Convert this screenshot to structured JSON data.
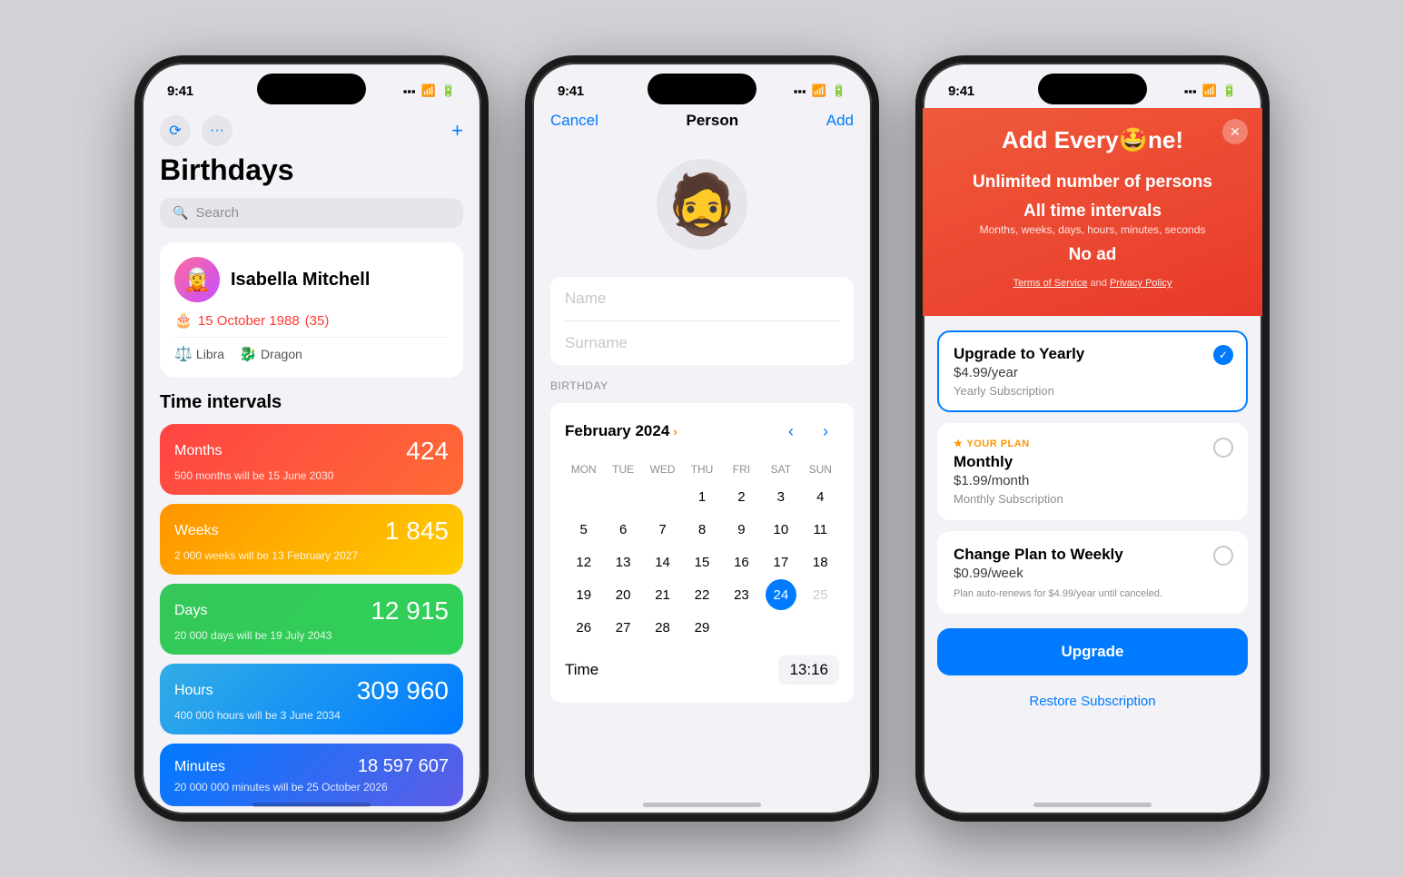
{
  "phone1": {
    "status": {
      "time": "9:41"
    },
    "toolbar": {
      "refresh_icon": "↻",
      "more_icon": "•••",
      "add_icon": "+"
    },
    "title": "Birthdays",
    "search": {
      "placeholder": "Search"
    },
    "person": {
      "name": "Isabella Mitchell",
      "avatar_emoji": "🧝",
      "birthday": "15 October 1988",
      "age": "(35)",
      "birthday_icon": "🎂",
      "zodiac": "Libra",
      "zodiac_icon": "♎",
      "chinese": "Dragon",
      "chinese_icon": "🐉"
    },
    "intervals_title": "Time intervals",
    "intervals": [
      {
        "label": "Months",
        "value": "424",
        "subtitle": "500 months will be 15 June 2030",
        "class": "card-months"
      },
      {
        "label": "Weeks",
        "value": "1 845",
        "subtitle": "2 000 weeks will be 13 February 2027",
        "class": "card-weeks"
      },
      {
        "label": "Days",
        "value": "12 915",
        "subtitle": "20 000 days will be 19 July 2043",
        "class": "card-days"
      },
      {
        "label": "Hours",
        "value": "309 960",
        "subtitle": "400 000 hours will be 3 June 2034",
        "class": "card-hours"
      },
      {
        "label": "Minutes",
        "value": "18 597 607",
        "subtitle": "20 000 000 minutes will be 25 October 2026",
        "class": "card-minutes"
      }
    ]
  },
  "phone2": {
    "status": {
      "time": "9:41"
    },
    "nav": {
      "cancel": "Cancel",
      "title": "Person",
      "add": "Add"
    },
    "form": {
      "name_placeholder": "Name",
      "surname_placeholder": "Surname"
    },
    "birthday_label": "BIRTHDAY",
    "calendar": {
      "month": "February 2024",
      "chevron": "›",
      "days_of_week": [
        "MON",
        "TUE",
        "WED",
        "THU",
        "FRI",
        "SAT",
        "SUN"
      ],
      "weeks": [
        [
          "",
          "",
          "",
          "1",
          "2",
          "3",
          "4"
        ],
        [
          "5",
          "6",
          "7",
          "8",
          "9",
          "10",
          "11"
        ],
        [
          "12",
          "13",
          "14",
          "15",
          "16",
          "17",
          "18"
        ],
        [
          "19",
          "20",
          "21",
          "22",
          "23",
          "24",
          "25"
        ],
        [
          "26",
          "27",
          "28",
          "29",
          "",
          "",
          ""
        ]
      ],
      "selected_day": "24",
      "muted_days": [
        "25",
        "26",
        "27",
        "28",
        "29"
      ]
    },
    "time": {
      "label": "Time",
      "value": "13:16"
    }
  },
  "phone3": {
    "status": {
      "time": "9:41"
    },
    "hero": {
      "title_pre": "Add Every",
      "title_emoji": "🤩",
      "title_post": "ne!",
      "features": [
        {
          "main": "Unlimited number of persons",
          "sub": ""
        },
        {
          "main": "All time intervals",
          "sub": "Months, weeks, days, hours, minutes, seconds"
        },
        {
          "main": "No ad",
          "sub": ""
        }
      ],
      "terms_pre": "Terms of Service",
      "terms_and": " and ",
      "terms_privacy": "Privacy Policy"
    },
    "plans": [
      {
        "id": "yearly",
        "name": "Upgrade to Yearly",
        "price": "$4.99/year",
        "desc": "Yearly Subscription",
        "selected": true,
        "your_plan": false,
        "note": ""
      },
      {
        "id": "monthly",
        "name": "Monthly",
        "price": "$1.99/month",
        "desc": "Monthly Subscription",
        "selected": false,
        "your_plan": true,
        "note": ""
      },
      {
        "id": "weekly",
        "name": "Change Plan to Weekly",
        "price": "$0.99/week",
        "desc": "",
        "selected": false,
        "your_plan": false,
        "note": "Plan auto-renews for $4.99/year until canceled."
      }
    ],
    "upgrade_btn": "Upgrade",
    "restore_btn": "Restore Subscription"
  }
}
